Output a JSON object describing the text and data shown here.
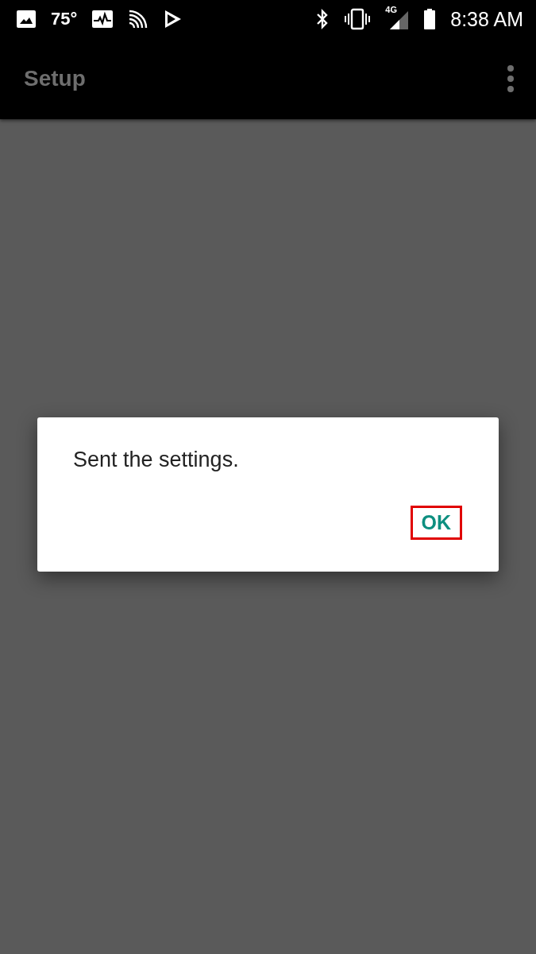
{
  "status_bar": {
    "temperature": "75°",
    "network": "4G",
    "time": "8:38 AM"
  },
  "app_bar": {
    "title": "Setup"
  },
  "dialog": {
    "message": "Sent the settings.",
    "buttons": [
      {
        "label": "OK",
        "highlighted": true
      }
    ]
  }
}
